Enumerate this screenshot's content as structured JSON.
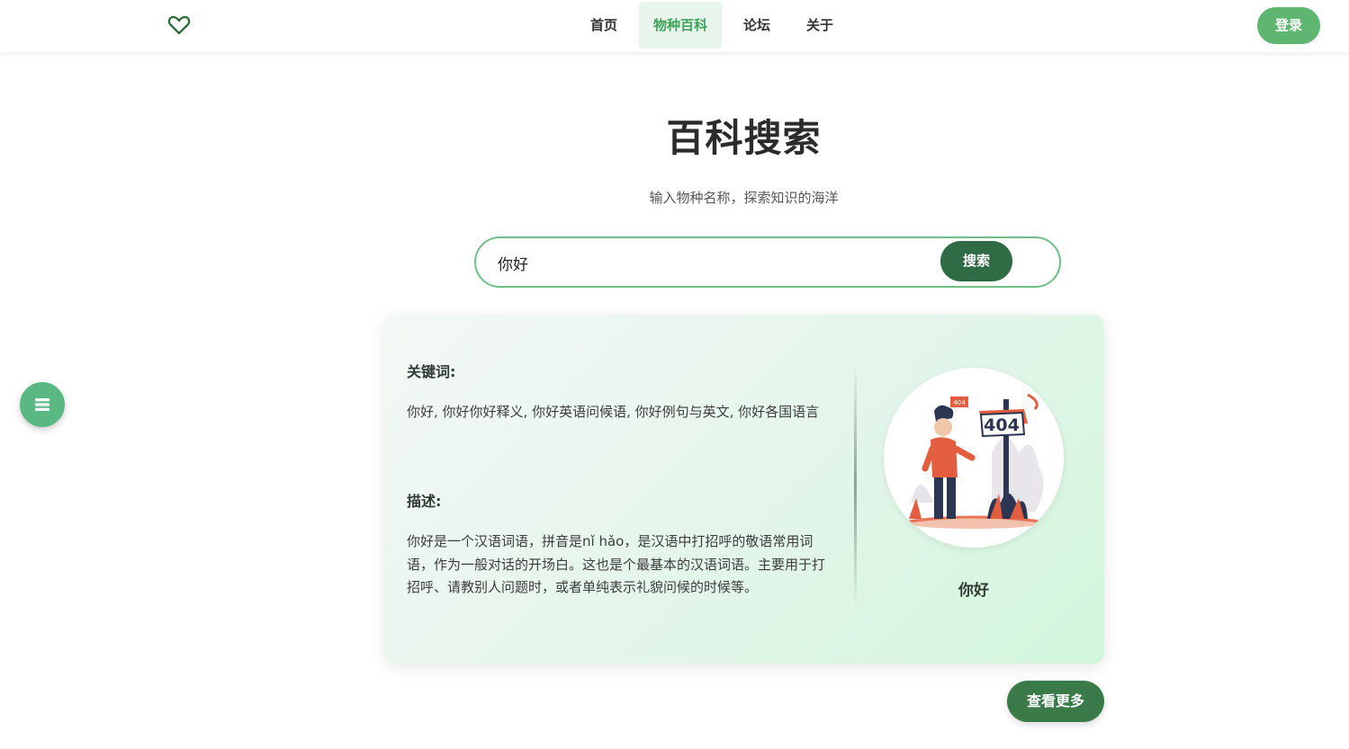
{
  "header": {
    "logo_icon": "heart-outline-icon",
    "nav": [
      {
        "label": "首页"
      },
      {
        "label": "物种百科"
      },
      {
        "label": "论坛"
      },
      {
        "label": "关于"
      }
    ],
    "active_nav": "物种百科",
    "login_label": "登录"
  },
  "hero": {
    "title": "百科搜索",
    "subtitle": "输入物种名称，探索知识的海洋"
  },
  "search": {
    "value": "你好",
    "button_label": "搜索"
  },
  "result": {
    "keywords_label": "关键词:",
    "keywords": "你好, 你好你好释义, 你好英语问候语, 你好例句与英文, 你好各国语言",
    "description_label": "描述:",
    "description": "你好是一个汉语词语，拼音是nǐ hǎo，是汉语中打招呼的敬语常用词语，作为一般对话的开场白。这也是个最基本的汉语词语。主要用于打招呼、请教别人问题时，或者单纯表示礼貌问候的时候等。",
    "image_caption": "你好",
    "image_sign_big": "404",
    "image_sign_small": "404"
  },
  "more_label": "查看更多",
  "fab_icon": "list-icon",
  "colors": {
    "accent": "#3fa45a",
    "dark_green": "#2f6b45",
    "login_green": "#5fb671"
  }
}
